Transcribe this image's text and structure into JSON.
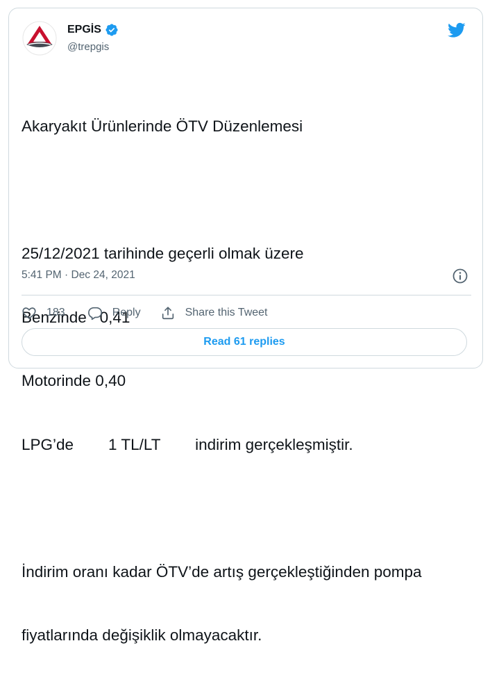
{
  "author": {
    "display_name": "EPGİS",
    "handle": "@trepgis",
    "verified": true
  },
  "tweet": {
    "lines": [
      "Akaryakıt Ürünlerinde ÖTV Düzenlemesi",
      "",
      "25/12/2021 tarihinde geçerli olmak üzere",
      "Benzinde   0,41",
      "Motorinde 0,40",
      "LPG’de        1 TL/LT        indirim gerçekleşmiştir.",
      "",
      "İndirim oranı kadar ÖTV’de artış gerçekleştiğinden pompa",
      "fiyatlarında değişiklik olmayacaktır."
    ],
    "timestamp": "5:41 PM · Dec 24, 2021"
  },
  "actions": {
    "like_count": "183",
    "reply_label": "Reply",
    "share_label": "Share this Tweet"
  },
  "read_replies_label": "Read 61 replies",
  "colors": {
    "twitter_blue": "#1d9bf0",
    "secondary_text": "#536471",
    "border": "#cfd9de",
    "logo_red": "#c8102e"
  },
  "icons": [
    "epgis-logo",
    "verified-badge-icon",
    "twitter-bird-icon",
    "info-icon",
    "heart-icon",
    "reply-icon",
    "share-icon"
  ]
}
